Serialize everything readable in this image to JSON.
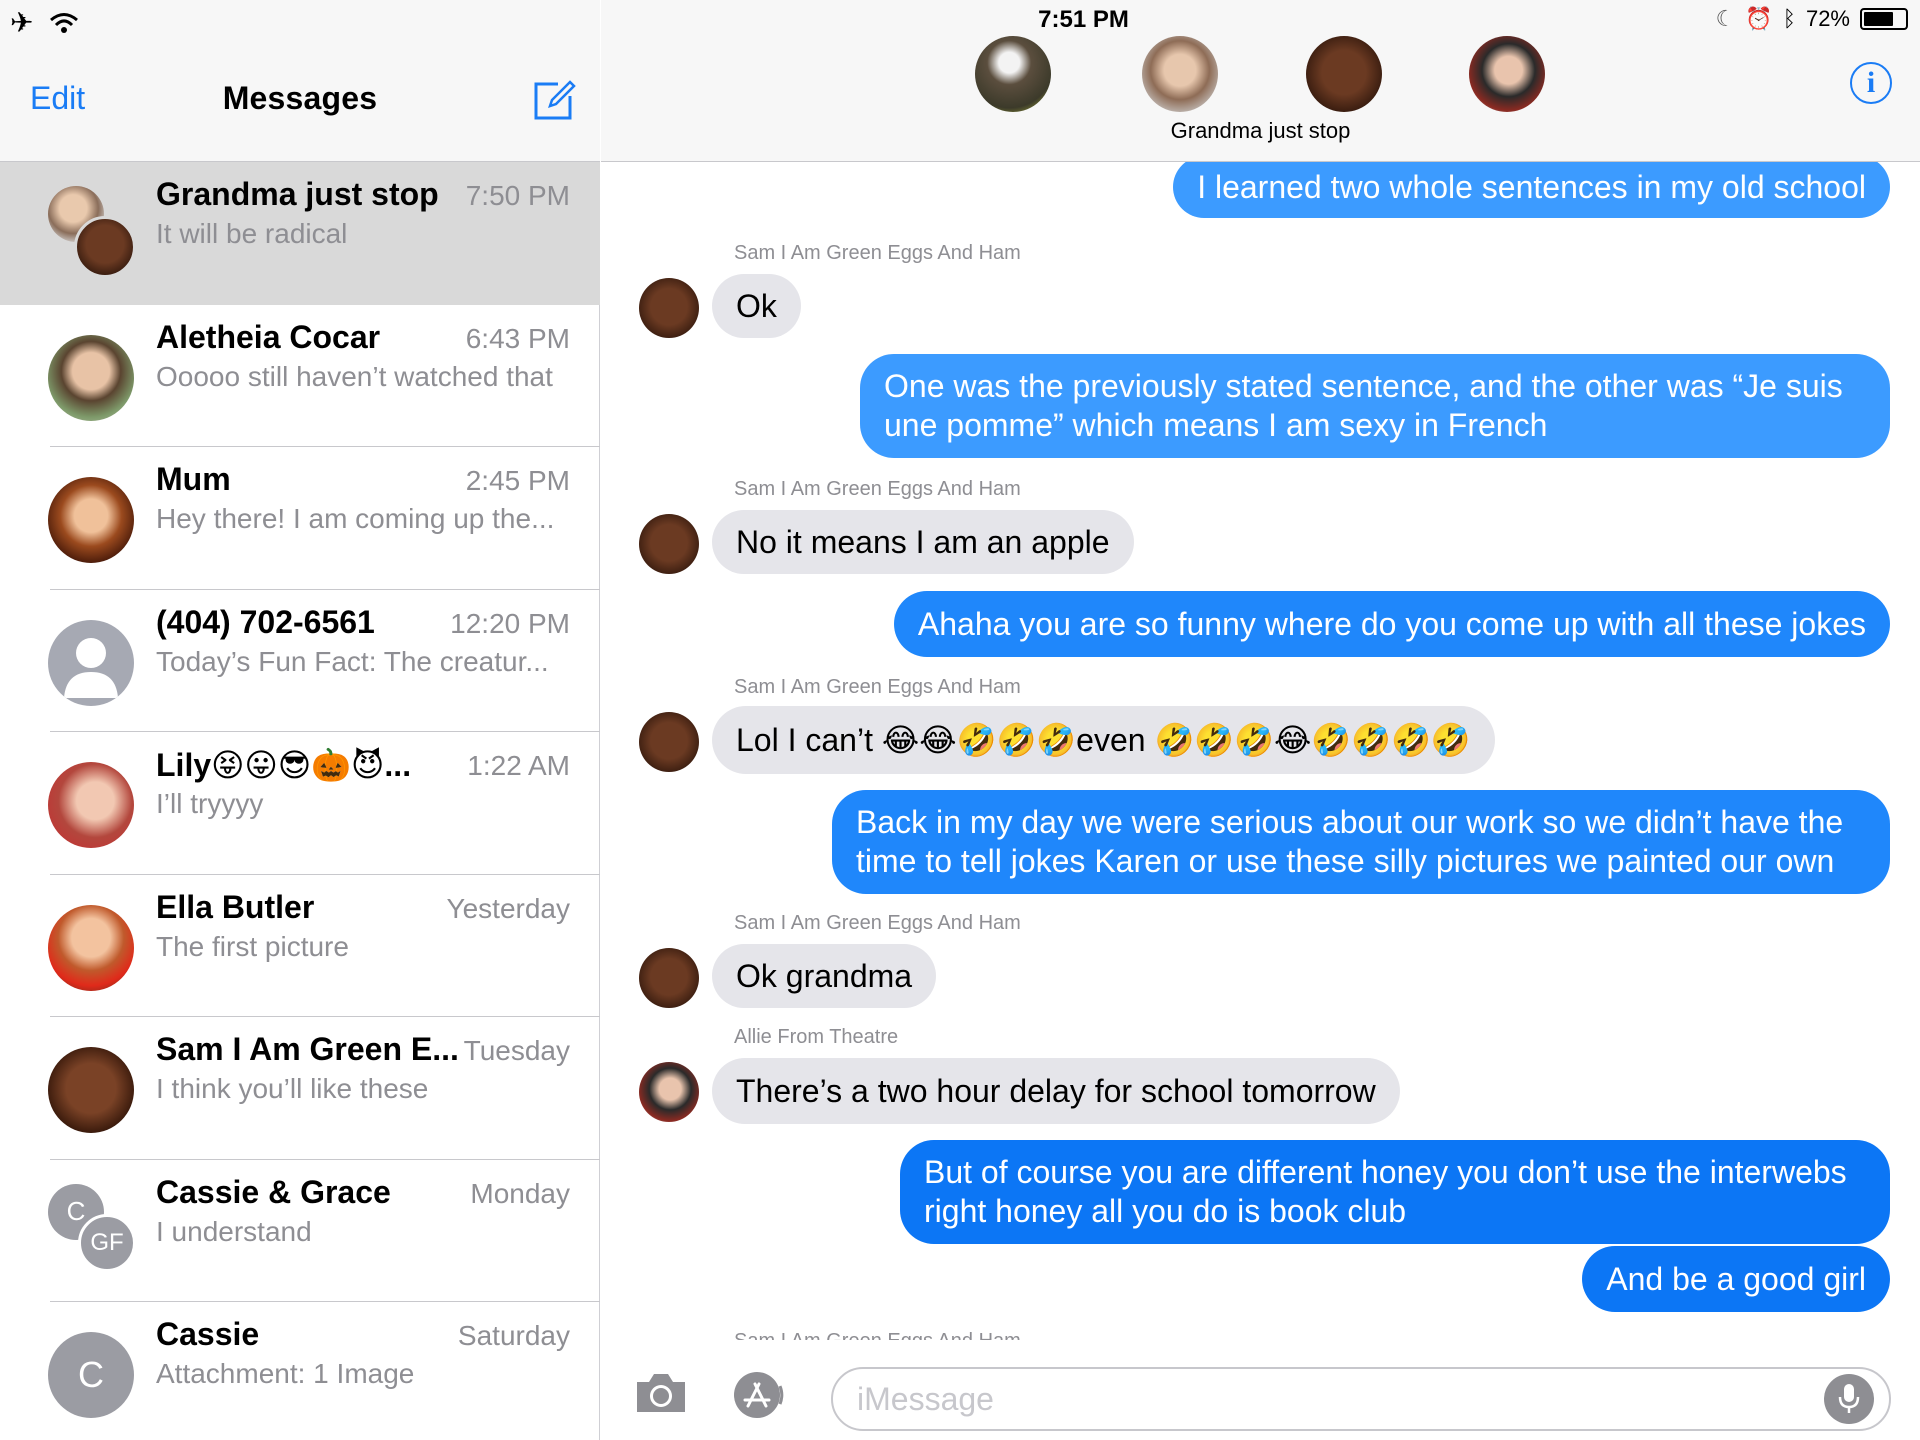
{
  "status_bar": {
    "time": "7:51 PM",
    "battery": "72%",
    "battery_level": 0.72
  },
  "sidebar": {
    "edit_label": "Edit",
    "title": "Messages",
    "conversations": [
      {
        "name": "Grandma just stop",
        "time": "7:50 PM",
        "preview": "It will be radical",
        "selected": true
      },
      {
        "name": "Aletheia Cocar",
        "time": "6:43 PM",
        "preview": "Ooooo still haven’t watched that"
      },
      {
        "name": "Mum",
        "time": "2:45 PM",
        "preview": "Hey there! I am coming up the..."
      },
      {
        "name": "(404) 702-6561",
        "time": "12:20 PM",
        "preview": "Today’s Fun Fact: The creatur..."
      },
      {
        "name": "Lily😝😛😎🎃😈...",
        "time": "1:22 AM",
        "preview": "I’ll tryyyy"
      },
      {
        "name": "Ella Butler",
        "time": "Yesterday",
        "preview": "The first picture"
      },
      {
        "name": "Sam I Am Green E...",
        "time": "Tuesday",
        "preview": "I think you’ll like these"
      },
      {
        "name": "Cassie & Grace",
        "time": "Monday",
        "preview": "I understand",
        "initials_a": "C",
        "initials_b": "GF"
      },
      {
        "name": "Cassie",
        "time": "Saturday",
        "preview": "Attachment: 1 Image",
        "initials": "C"
      }
    ]
  },
  "chat": {
    "group_name": "Grandma just stop",
    "messages": [
      {
        "dir": "out",
        "text": "I learned two whole sentences in my old school"
      },
      {
        "dir": "in",
        "sender": "Sam I Am Green Eggs And Ham",
        "text": "Ok"
      },
      {
        "dir": "out",
        "text": "One was the previously stated sentence, and the other was “Je suis une pomme” which means I am sexy in French"
      },
      {
        "dir": "in",
        "sender": "Sam I Am Green Eggs And Ham",
        "text": "No it means I am an apple"
      },
      {
        "dir": "out",
        "text": "Ahaha you are so funny where do you come up with all these jokes"
      },
      {
        "dir": "in",
        "sender": "Sam I Am Green Eggs And Ham",
        "text": "Lol I can’t 😂😂🤣🤣🤣even 🤣🤣🤣😂🤣🤣🤣🤣"
      },
      {
        "dir": "out",
        "text": "Back in my day we were serious about our work so we didn’t have the time to tell jokes Karen or use these silly pictures we painted our own"
      },
      {
        "dir": "in",
        "sender": "Sam I Am Green Eggs And Ham",
        "text": "Ok grandma"
      },
      {
        "dir": "in",
        "sender": "Allie From Theatre",
        "text": "There’s a two hour delay for school tomorrow"
      },
      {
        "dir": "out",
        "text": "But of course you are different honey you don’t use the interwebs right honey all you do is book club"
      },
      {
        "dir": "out",
        "text": "And be a good girl"
      }
    ],
    "typing_sender": "Sam I Am Green Eggs And Ham"
  },
  "compose": {
    "placeholder": "iMessage"
  },
  "colors": {
    "accent": "#1a7cf5",
    "bubble_in": "#e5e5ea",
    "bubble_out_top": "#3c9bff",
    "bubble_out_bottom": "#0c76f5",
    "muted": "#8e8e93"
  }
}
